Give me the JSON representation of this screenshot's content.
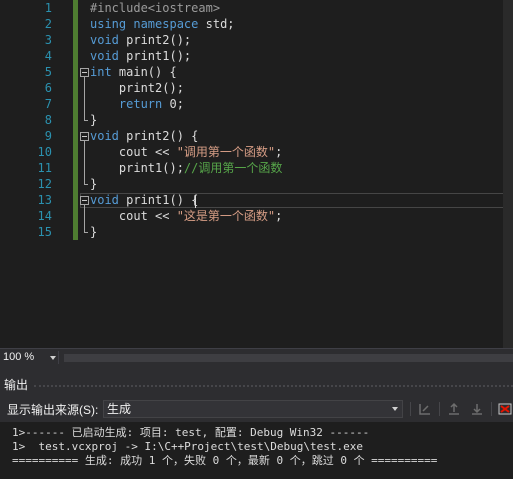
{
  "editor": {
    "line_numbers": [
      "1",
      "2",
      "3",
      "4",
      "5",
      "6",
      "7",
      "8",
      "9",
      "10",
      "11",
      "12",
      "13",
      "14",
      "15"
    ],
    "lines": [
      {
        "pp": "#include<iostream>"
      },
      {
        "kw1": "using",
        "sp1": " ",
        "kw2": "namespace",
        "rest": " std;"
      },
      {
        "kw": "void",
        "rest": " print2();"
      },
      {
        "kw": "void",
        "rest": " print1();"
      },
      {
        "kw": "int",
        "rest": " main() {"
      },
      {
        "rest": "    print2();"
      },
      {
        "indent": "    ",
        "kw": "return",
        "rest": " 0;"
      },
      {
        "rest": "}"
      },
      {
        "kw": "void",
        "rest": " print2() {"
      },
      {
        "pre": "    cout << ",
        "str": "\"调用第一个函数\"",
        "post": ";"
      },
      {
        "pre": "    print1();",
        "cm": "//调用第一个函数"
      },
      {
        "rest": "}"
      },
      {
        "kw": "void",
        "rest": " print1() {"
      },
      {
        "pre": "    cout << ",
        "str": "\"这是第一个函数\"",
        "post": ";"
      },
      {
        "rest": "}"
      }
    ]
  },
  "zoom": {
    "value": "100 %"
  },
  "output": {
    "title": "输出",
    "show_from_label": "显示输出来源(S):",
    "source_value": "生成",
    "lines": [
      "1>------ 已启动生成: 项目: test, 配置: Debug Win32 ------",
      "1>  test.vcxproj -> I:\\C++Project\\test\\Debug\\test.exe",
      "========== 生成: 成功 1 个，失败 0 个，最新 0 个，跳过 0 个 =========="
    ]
  },
  "colors": {
    "background": "#1e1e1e",
    "keyword": "#569cd6",
    "string": "#d69d85",
    "comment": "#57a64a",
    "preprocessor": "#9b9b9b",
    "line_number": "#2b91af",
    "change_bar": "#4e7d31"
  }
}
